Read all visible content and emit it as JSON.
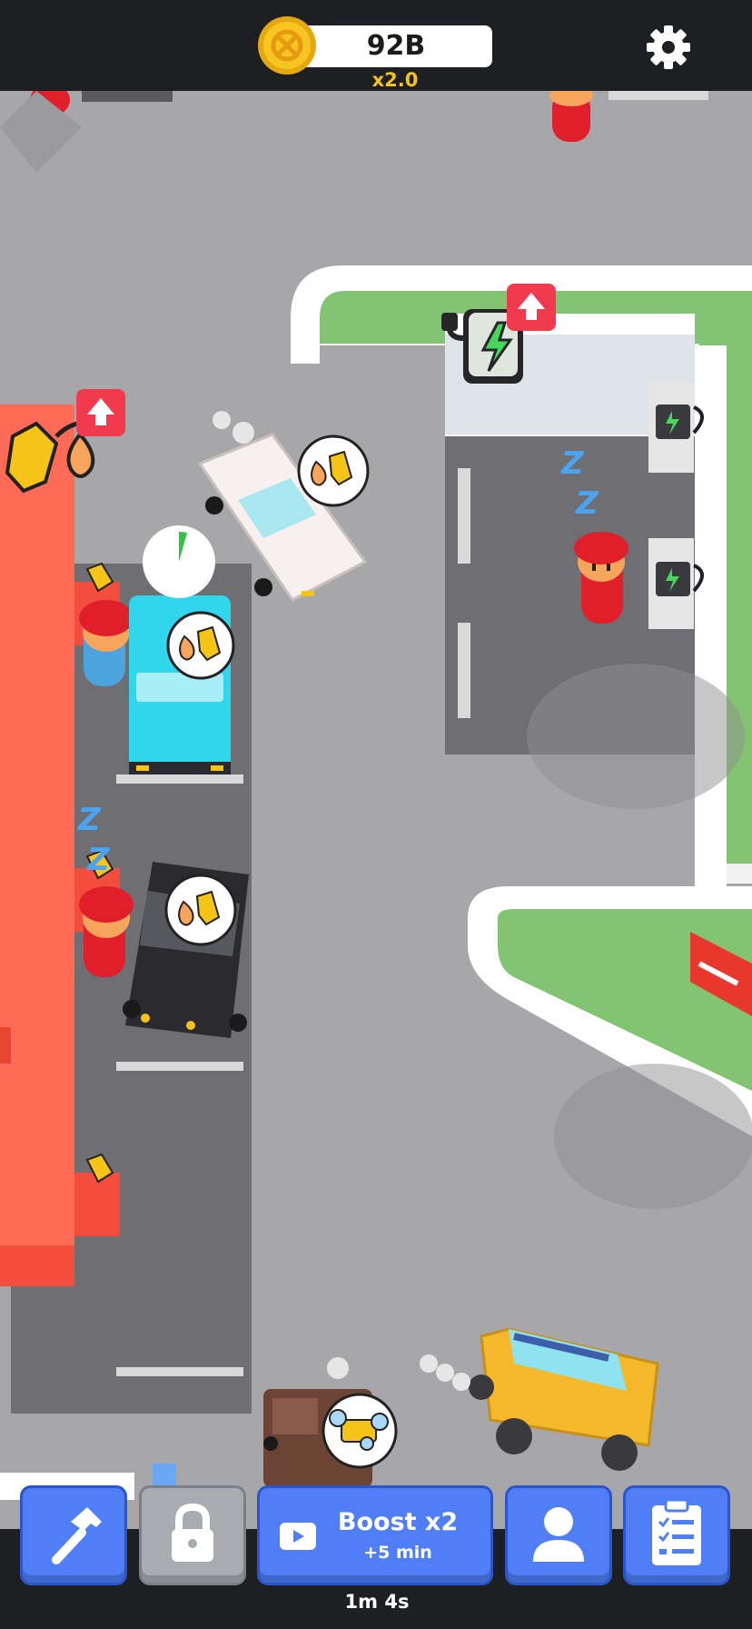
{
  "header": {
    "coins": "92B",
    "multiplier": "x2.0",
    "coin_icon": "coin-icon",
    "settings_icon": "gear-icon"
  },
  "world": {
    "sleep_indicator": "Z",
    "upgrade_icon": "up-arrow-icon",
    "fuel_request_icon": "fuel-nozzle-drop-icon",
    "wash_request_icon": "soap-bubbles-icon",
    "ev_charger_icon": "lightning-charger-icon",
    "cars": [
      "white-car",
      "cyan-van",
      "black-pickup",
      "yellow-jeep",
      "brown-truck"
    ]
  },
  "toolbar": {
    "build_icon": "hammer-icon",
    "lock_icon": "padlock-icon",
    "boost_label": "Boost x2",
    "boost_sub": "+5 min",
    "boost_icon": "video-play-icon",
    "staff_icon": "person-icon",
    "tasks_icon": "checklist-icon",
    "timer": "1m 4s"
  },
  "colors": {
    "bar": "#1e1f22",
    "button_blue": "#4f7ef7",
    "button_gray": "#a9abb2",
    "coin_gold": "#f5c417",
    "road": "#a7a7a9",
    "grass": "#82c471",
    "building_red": "#ff6b57",
    "upgrade_red": "#f23a4f"
  }
}
